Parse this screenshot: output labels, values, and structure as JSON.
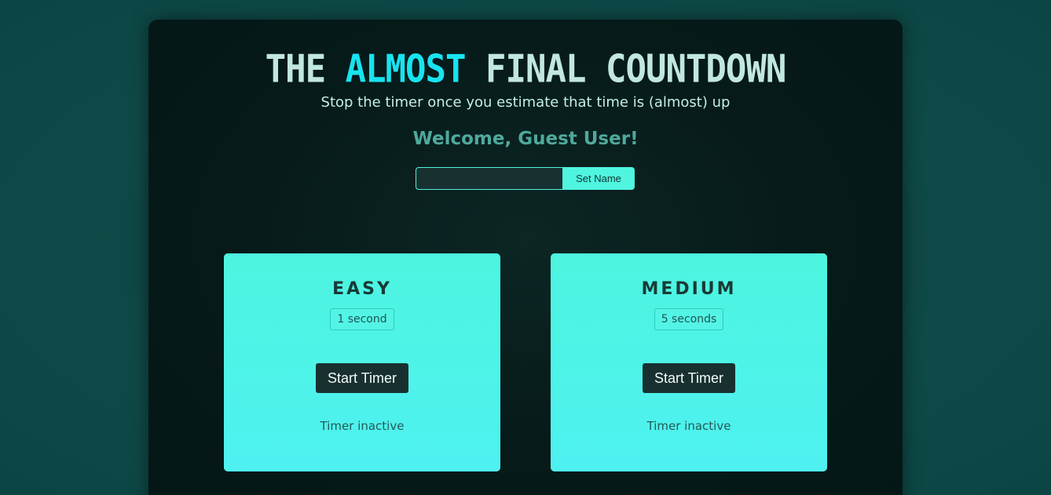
{
  "header": {
    "title_part1": "THE",
    "title_accent": "ALMOST",
    "title_part2": "FINAL COUNTDOWN",
    "subtitle": "Stop the timer once you estimate that time is (almost) up",
    "welcome": "Welcome, Guest User!"
  },
  "name_form": {
    "input_value": "",
    "input_placeholder": "",
    "button_label": "Set Name"
  },
  "cards": [
    {
      "title": "EASY",
      "duration": "1 second",
      "button_label": "Start Timer",
      "status": "Timer inactive"
    },
    {
      "title": "MEDIUM",
      "duration": "5 seconds",
      "button_label": "Start Timer",
      "status": "Timer inactive"
    }
  ],
  "colors": {
    "accent": "#18e3f0",
    "card": "#4df5e0",
    "button_dark": "#183130",
    "welcome": "#4fa99c"
  }
}
